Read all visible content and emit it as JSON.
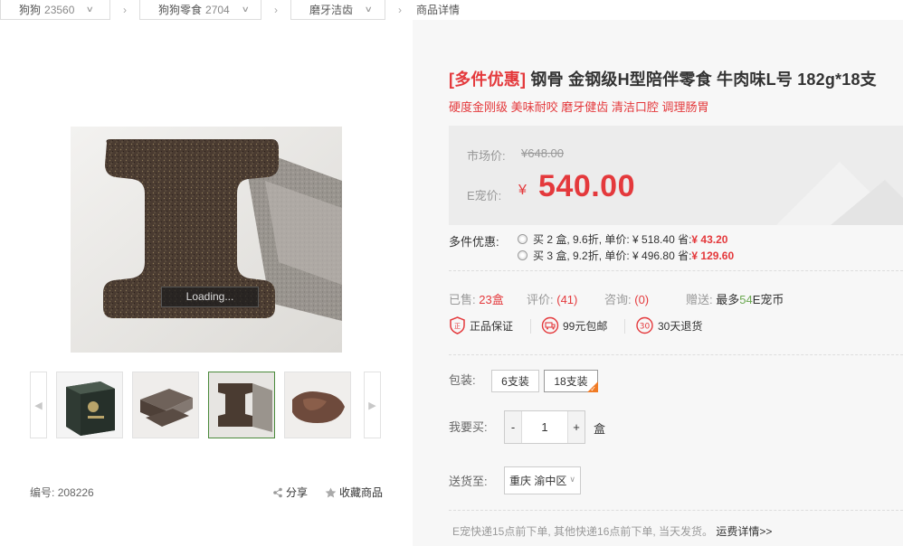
{
  "breadcrumb": {
    "items": [
      {
        "label": "狗狗",
        "count": "23560"
      },
      {
        "label": "狗狗零食",
        "count": "2704"
      },
      {
        "label": "磨牙洁齿",
        "count": ""
      }
    ],
    "current": "商品详情"
  },
  "gallery": {
    "loading_text": "Loading...",
    "thumbnails": [
      "package-box",
      "h-bone-pieces",
      "h-bone-cross-section",
      "bitten-bone"
    ],
    "active_index": 2
  },
  "footer_left": {
    "sku_label": "编号:",
    "sku_value": "208226",
    "share_label": "分享",
    "favorite_label": "收藏商品"
  },
  "product": {
    "tag": "[多件优惠]",
    "name": " 钢骨 金钢级H型陪伴零食 牛肉味L号 182g*18支",
    "subtitle": "硬度金刚级 美味耐咬 磨牙健齿 清洁口腔 调理肠胃"
  },
  "price": {
    "market_label": "市场价:",
    "market_value": "¥648.00",
    "e_label": "E宠价:",
    "currency": "¥",
    "e_value": "540.00"
  },
  "multi_discount": {
    "label": "多件优惠:",
    "options": [
      {
        "text": "买 2 盒, 9.6折, 单价: ¥ 518.40  省: ",
        "save": "¥ 43.20"
      },
      {
        "text": "买 3 盒, 9.2折, 单价: ¥ 496.80  省: ",
        "save": "¥ 129.60"
      }
    ]
  },
  "stats": {
    "sold_label": "已售:",
    "sold_value": "23盒",
    "review_label": "评价:",
    "review_value": "(41)",
    "consult_label": "咨询:",
    "consult_value": "(0)",
    "gift_label": "赠送:",
    "gift_prefix": "最多",
    "gift_value": "54",
    "gift_suffix": "E宠币"
  },
  "guarantees": [
    {
      "icon": "shield-icon",
      "label": "正品保证"
    },
    {
      "icon": "truck-icon",
      "label": "99元包邮"
    },
    {
      "icon": "return-30-icon",
      "label": "30天退货"
    }
  ],
  "packaging": {
    "label": "包装:",
    "options": [
      "6支装",
      "18支装"
    ],
    "selected_index": 1
  },
  "quantity": {
    "label": "我要买:",
    "minus": "-",
    "plus": "+",
    "value": "1",
    "unit": "盒"
  },
  "delivery": {
    "label": "送货至:",
    "region": "重庆 渝中区"
  },
  "shipping_note": {
    "text": "E宠快递15点前下单, 其他快递16点前下单, 当天发货。 ",
    "link": "运费详情>>"
  },
  "colors": {
    "accent_red": "#e4393c",
    "selected_orange": "#f07b25",
    "thumb_active_green": "#4a8a3b"
  }
}
